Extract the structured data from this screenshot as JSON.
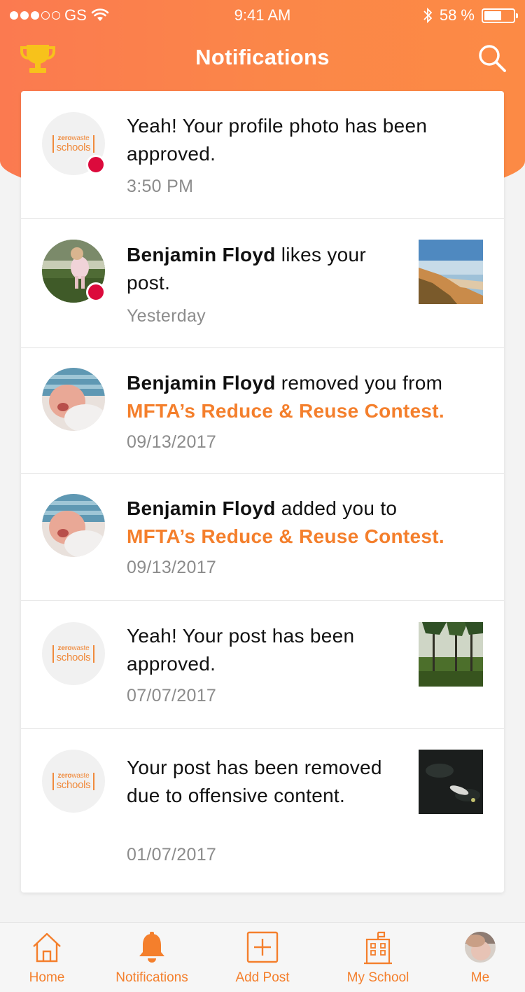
{
  "status_bar": {
    "carrier": "GS",
    "time": "9:41 AM",
    "battery": "58 %"
  },
  "header": {
    "title": "Notifications"
  },
  "notifications": [
    {
      "avatar": "zerowaste-schools-logo",
      "unread": true,
      "text": "Yeah! Your profile photo has been approved.",
      "time": "3:50 PM",
      "thumbnail": null
    },
    {
      "avatar": "user-photo-child-on-grass",
      "unread": true,
      "actor": "Benjamin Floyd",
      "text": "likes your post.",
      "time": "Yesterday",
      "thumbnail": "beach-photo"
    },
    {
      "avatar": "user-photo-baby",
      "unread": false,
      "actor": "Benjamin Floyd",
      "text": "removed you from",
      "link": "MFTA’s Reduce & Reuse Contest.",
      "time": "09/13/2017",
      "thumbnail": null
    },
    {
      "avatar": "user-photo-baby",
      "unread": false,
      "actor": "Benjamin Floyd",
      "text": "added you to",
      "link": "MFTA’s Reduce & Reuse Contest.",
      "time": "09/13/2017",
      "thumbnail": null
    },
    {
      "avatar": "zerowaste-schools-logo",
      "unread": false,
      "text": "Yeah! Your post has been approved.",
      "time": "07/07/2017",
      "thumbnail": "forest-photo"
    },
    {
      "avatar": "zerowaste-schools-logo",
      "unread": false,
      "text": "Your post has been removed due to offensive content.",
      "time": "01/07/2017",
      "thumbnail": "dark-water-photo"
    }
  ],
  "logo": {
    "top_bold": "zero",
    "top_light": "waste",
    "bottom": "schools"
  },
  "tab_bar": {
    "home": "Home",
    "notifications": "Notifications",
    "add_post": "Add Post",
    "my_school": "My School",
    "me": "Me"
  },
  "colors": {
    "accent": "#f47f2c",
    "header_gradient_start": "#fb7a50",
    "header_gradient_end": "#fc8a45",
    "unread_dot": "#dc0a3c",
    "trophy": "#f7c21b"
  }
}
